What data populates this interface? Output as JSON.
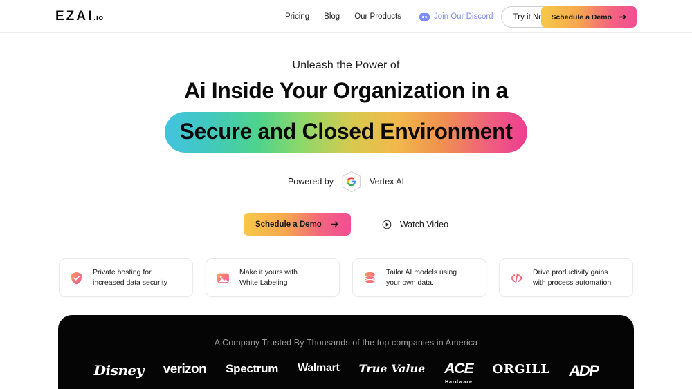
{
  "header": {
    "logo_main": "EZAI",
    "logo_suffix": ".io",
    "nav": [
      {
        "label": "Pricing",
        "name": "nav-pricing"
      },
      {
        "label": "Blog",
        "name": "nav-blog"
      },
      {
        "label": "Our Products",
        "name": "nav-our-products"
      }
    ],
    "discord_label": "Join Our Discord",
    "discord_color": "#7d8df0",
    "try_label": "Try it Now",
    "demo_label": "Schedule a Demo"
  },
  "hero": {
    "eyebrow": "Unleash the Power of",
    "headline": "Ai Inside Your Organization in a",
    "highlight": "Secure and Closed Environment",
    "powered_by": "Powered by",
    "powered_brand": "Vertex AI",
    "cta_primary": "Schedule a Demo",
    "cta_secondary": "Watch Video"
  },
  "features": [
    {
      "icon": "shield-check-icon",
      "line1": "Private hosting for",
      "line2": "increased data security"
    },
    {
      "icon": "image-icon",
      "line1": "Make it yours with",
      "line2": "White Labeling"
    },
    {
      "icon": "database-icon",
      "line1": "Tailor AI models using",
      "line2": "your own data."
    },
    {
      "icon": "code-icon",
      "line1": "Drive productivity gains",
      "line2": "with process automation"
    }
  ],
  "trust": {
    "title": "A Company Trusted By Thousands of the top companies in America",
    "background": "#050505",
    "title_color": "#9b9b9b",
    "logos": [
      {
        "name": "logo-disney",
        "label": "Disney"
      },
      {
        "name": "logo-verizon",
        "label": "verizon"
      },
      {
        "name": "logo-spectrum",
        "label": "Spectrum"
      },
      {
        "name": "logo-walmart",
        "label": "Walmart"
      },
      {
        "name": "logo-truevalue",
        "label": "True Value"
      },
      {
        "name": "logo-ace",
        "label": "ACE",
        "sublabel": "Hardware"
      },
      {
        "name": "logo-orgill",
        "label": "ORGILL"
      },
      {
        "name": "logo-adp",
        "label": "ADP"
      }
    ]
  },
  "colors": {
    "gradient_start": "#f7c948",
    "gradient_end": "#f14d95",
    "rainbow_start": "#44c3e0",
    "rainbow_mid": "#d9c94e",
    "rainbow_end": "#ee3d92",
    "text": "#111111"
  }
}
